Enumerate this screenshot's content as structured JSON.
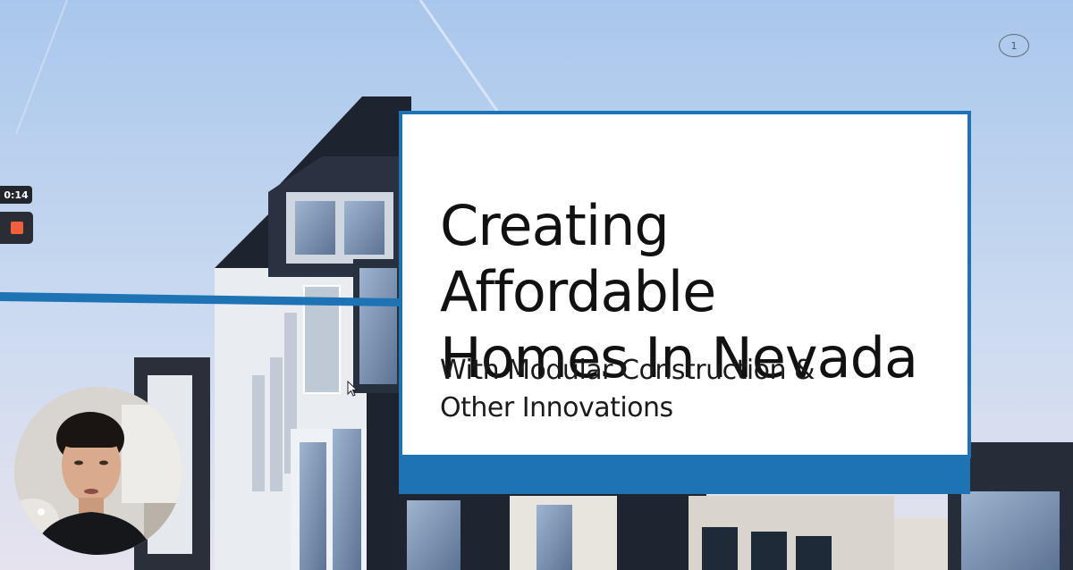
{
  "recording": {
    "elapsed": "0:14",
    "stop_icon": "stop-square-icon",
    "stop_color": "#f0603c"
  },
  "slide": {
    "number": "1",
    "title": "Creating Affordable\nHomes In Nevada",
    "subtitle": "With Modular Construction &\nOther Innovations"
  },
  "theme": {
    "accent": "#1e73b4",
    "card_background": "#ffffff"
  },
  "webcam": {
    "icon": "presenter-video-feed"
  },
  "pointer": {
    "icon": "mouse-cursor-icon"
  }
}
